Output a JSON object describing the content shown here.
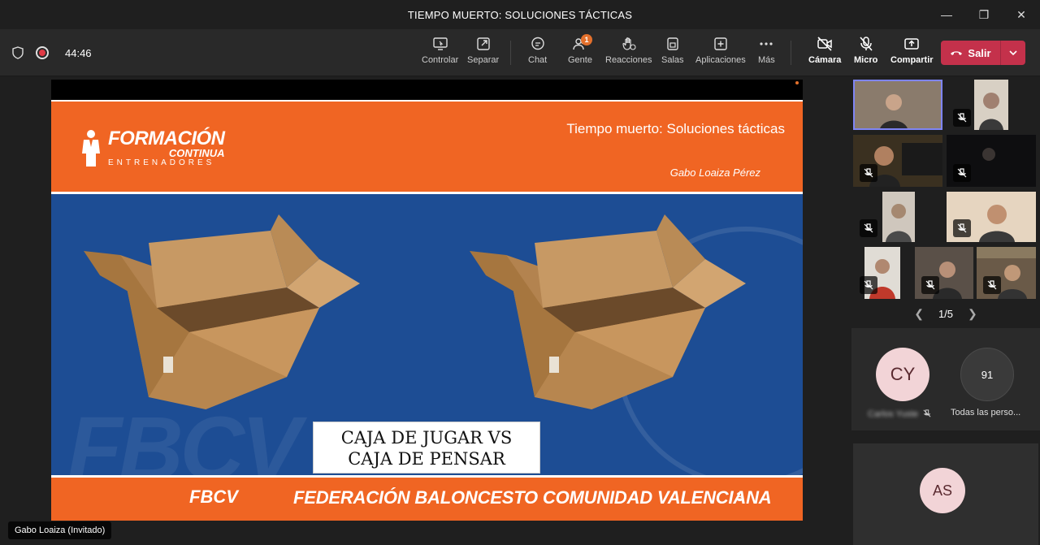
{
  "window": {
    "title": "TIEMPO MUERTO: SOLUCIONES TÁCTICAS"
  },
  "toolbar": {
    "timer": "44:46",
    "buttons": [
      {
        "id": "controlar",
        "label": "Controlar",
        "icon": "monitor-icon"
      },
      {
        "id": "separar",
        "label": "Separar",
        "icon": "pop-out-icon"
      },
      {
        "id": "chat",
        "label": "Chat",
        "icon": "chat-icon"
      },
      {
        "id": "gente",
        "label": "Gente",
        "icon": "people-icon",
        "badge": "1"
      },
      {
        "id": "reacciones",
        "label": "Reacciones",
        "icon": "hand-icon"
      },
      {
        "id": "salas",
        "label": "Salas",
        "icon": "rooms-icon"
      },
      {
        "id": "aplicaciones",
        "label": "Aplicaciones",
        "icon": "plus-icon"
      },
      {
        "id": "mas",
        "label": "Más",
        "icon": "more-icon"
      },
      {
        "id": "camara",
        "label": "Cámara",
        "icon": "camera-off-icon"
      },
      {
        "id": "micro",
        "label": "Micro",
        "icon": "mic-off-icon"
      },
      {
        "id": "compartir",
        "label": "Compartir",
        "icon": "share-icon"
      }
    ],
    "leave_label": "Salir"
  },
  "slide": {
    "logo_line1": "FORMACIÓN",
    "logo_line2": "CONTINUA",
    "logo_line3": "ENTRENADORES",
    "title": "Tiempo muerto: Soluciones tácticas",
    "author": "Gabo Loaiza Pérez",
    "caption_line1": "CAJA DE JUGAR VS",
    "caption_line2": "CAJA DE PENSAR",
    "watermark": "FBCV",
    "footer_logo": "FBCV",
    "footer_text": "FEDERACIÓN BALONCESTO COMUNIDAD VALENCIANA",
    "page_number": "3"
  },
  "presenter": {
    "name": "Gabo Loaiza (Invitado)"
  },
  "rail": {
    "pager": "1/5",
    "avatars": [
      {
        "initials": "CY",
        "name": "Carlos Yuste",
        "color": "#f2d4d7"
      },
      {
        "initials": "91",
        "name": "Todas las perso...",
        "color": "#3a3a3a"
      }
    ],
    "bottom_avatar": {
      "initials": "AS",
      "color": "#f2d4d7"
    }
  }
}
